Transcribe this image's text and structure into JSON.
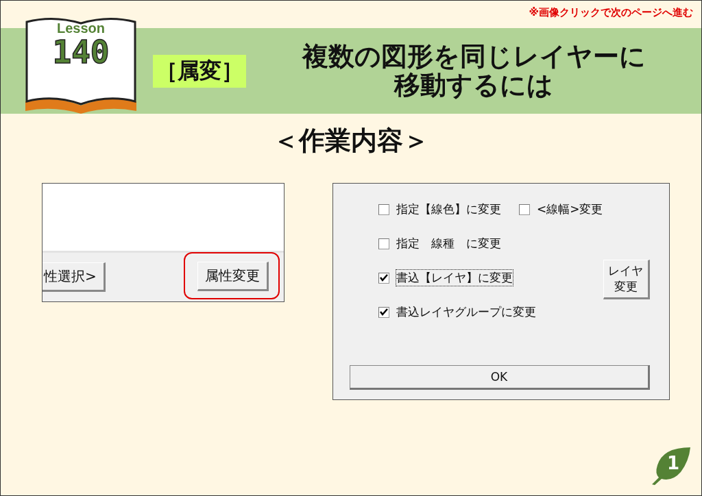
{
  "note": "※画像クリックで次のページへ進む",
  "lesson": {
    "label": "Lesson",
    "number": "140"
  },
  "tag": "［属変］",
  "title_lines": [
    "複数の図形を同じレイヤーに",
    "移動するには"
  ],
  "section_heading": "＜作業内容＞",
  "left_panel": {
    "buttons": [
      {
        "label": "性選択>",
        "highlighted": false
      },
      {
        "label": "属性変更",
        "highlighted": true
      }
    ]
  },
  "dialog": {
    "rows": [
      [
        {
          "label": "指定【線色】に変更",
          "checked": false,
          "focused": false
        },
        {
          "label": "<線幅>変更",
          "checked": false,
          "focused": false
        }
      ],
      [
        {
          "label": "指定　線種　に変更",
          "checked": false,
          "focused": false
        }
      ],
      [
        {
          "label": "書込【レイヤ】に変更",
          "checked": true,
          "focused": true
        }
      ],
      [
        {
          "label": "書込レイヤグループに変更",
          "checked": true,
          "focused": false
        }
      ]
    ],
    "layer_button": "レイヤ変更",
    "ok_button": "OK"
  },
  "page_number": "1"
}
